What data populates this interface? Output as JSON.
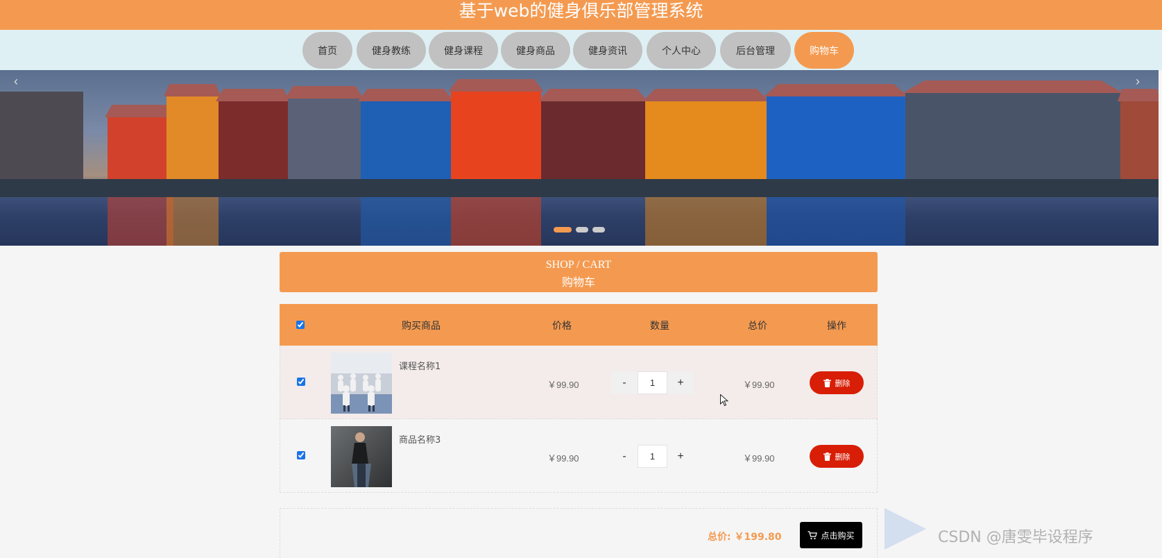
{
  "app": {
    "title": "基于web的健身俱乐部管理系统"
  },
  "nav": {
    "items": [
      {
        "label": "首页"
      },
      {
        "label": "健身教练"
      },
      {
        "label": "健身课程"
      },
      {
        "label": "健身商品"
      },
      {
        "label": "健身资讯"
      },
      {
        "label": "个人中心"
      },
      {
        "label": "后台管理"
      },
      {
        "label": "购物车",
        "active": true
      }
    ]
  },
  "banner": {
    "slide_count": 3,
    "active_slide": 1,
    "prev_icon": "chevron-left-icon",
    "next_icon": "chevron-right-icon"
  },
  "section": {
    "title_en": "SHOP / CART",
    "title_cn": "购物车"
  },
  "cart": {
    "headers": {
      "product": "购买商品",
      "price": "价格",
      "quantity": "数量",
      "total": "总价",
      "action": "操作"
    },
    "select_all": true,
    "items": [
      {
        "name": "课程名称1",
        "price": "￥99.90",
        "quantity": "1",
        "subtotal": "￥99.90",
        "checked": true,
        "delete_label": "删除",
        "thumb": "group-fitness-class-photo"
      },
      {
        "name": "商品名称3",
        "price": "￥99.90",
        "quantity": "1",
        "subtotal": "￥99.90",
        "checked": true,
        "delete_label": "删除",
        "thumb": "sportswear-model-photo"
      }
    ],
    "minus_label": "-",
    "plus_label": "+"
  },
  "footer": {
    "total_label": "总价: ￥199.80",
    "buy_label": "点击购买"
  },
  "watermark": "CSDN @唐雯毕设程序",
  "colors": {
    "accent": "#f49a50",
    "nav_inactive": "#c1c1c1",
    "nav_bg": "#dff0f4",
    "delete": "#d81e06",
    "buy": "#000000"
  }
}
